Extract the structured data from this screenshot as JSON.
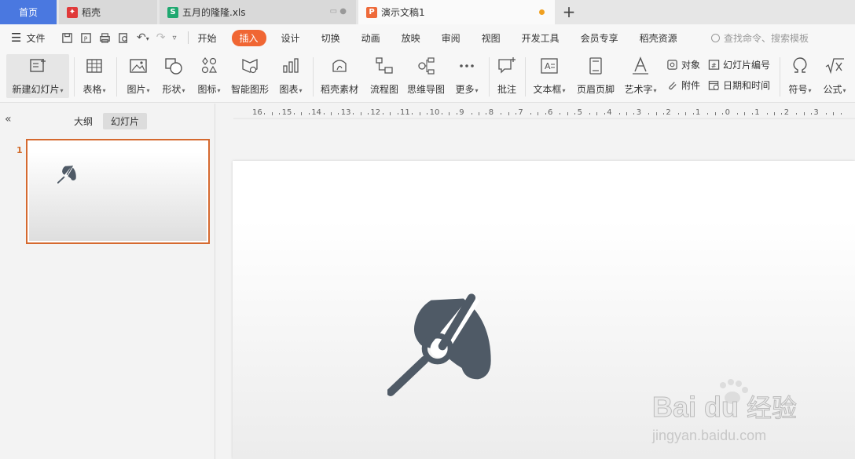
{
  "tabs": {
    "home": "首页",
    "tab1": "稻壳",
    "tab2": "五月的隆隆.xls",
    "tab3": "演示文稿1",
    "new_tab": "+"
  },
  "menubar": {
    "file": "文件",
    "items": [
      "开始",
      "插入",
      "设计",
      "切换",
      "动画",
      "放映",
      "审阅",
      "视图",
      "开发工具",
      "会员专享",
      "稻壳资源"
    ],
    "active": "插入",
    "search_placeholder": "查找命令、搜索模板"
  },
  "ribbon": {
    "new_slide": "新建幻灯片",
    "table": "表格",
    "picture": "图片",
    "shape": "形状",
    "icon": "图标",
    "smartart": "智能图形",
    "chart": "图表",
    "docer_material": "稻壳素材",
    "flowchart": "流程图",
    "mindmap": "思维导图",
    "more": "更多",
    "comment": "批注",
    "textbox": "文本框",
    "header_footer": "页眉页脚",
    "wordart": "艺术字",
    "object": "对象",
    "attachment": "附件",
    "slide_number": "幻灯片编号",
    "date_time": "日期和时间",
    "symbol": "符号",
    "formula": "公式"
  },
  "leftpanel": {
    "outline_tab": "大纲",
    "slides_tab": "幻灯片",
    "slide_number": "1"
  },
  "ruler": {
    "labels": [
      "16",
      "15",
      "14",
      "13",
      "12",
      "11",
      "10",
      "9",
      "8",
      "7",
      "6",
      "5",
      "4",
      "3",
      "2",
      "1",
      "0",
      "1",
      "2",
      "3"
    ]
  },
  "watermark": {
    "brand": "Baidu经验",
    "url": "jingyan.baidu.com"
  },
  "colors": {
    "accent": "#f06633",
    "home_tab": "#4a78e0",
    "icon_dark": "#4f5a66",
    "thumb_border": "#d5692f"
  }
}
